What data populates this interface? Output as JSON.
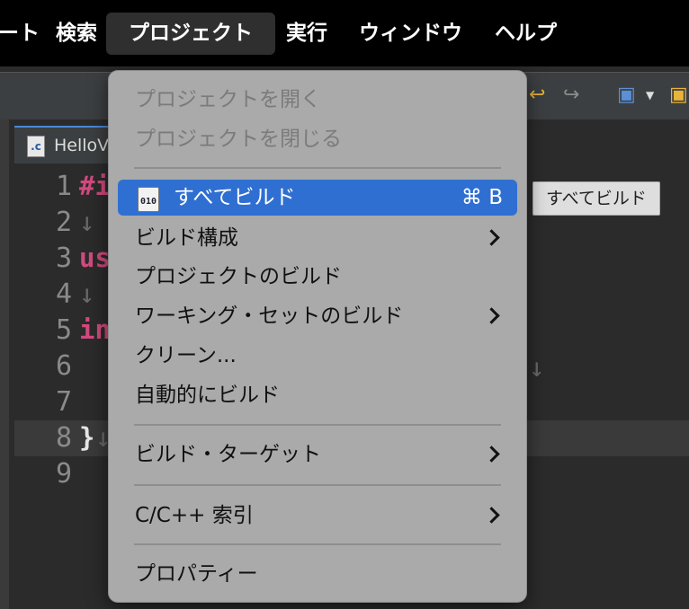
{
  "menubar": {
    "items": [
      "ート",
      "検索",
      "プロジェクト",
      "実行",
      "ウィンドウ",
      "ヘルプ"
    ]
  },
  "editor": {
    "tab_label": "HelloV",
    "file_icon_text": ".c",
    "line_numbers": [
      "1",
      "2",
      "3",
      "4",
      "5",
      "6",
      "7",
      "8",
      "9"
    ],
    "code_fragments": {
      "l1": "#i",
      "l2": "↓",
      "l3": "us",
      "l4": "↓",
      "l5": "in",
      "l6": "↓",
      "l8_brace": "}",
      "l8_ws": "↓"
    }
  },
  "tooltip": {
    "text": "すべてビルド"
  },
  "menu": {
    "items": [
      {
        "label": "プロジェクトを開く",
        "disabled": true
      },
      {
        "label": "プロジェクトを閉じる",
        "disabled": true
      },
      {
        "label": "すべてビルド",
        "shortcut": "⌘ B",
        "selected": true,
        "icon_text": "010"
      },
      {
        "label": "ビルド構成",
        "submenu": true
      },
      {
        "label": "プロジェクトのビルド"
      },
      {
        "label": "ワーキング・セットのビルド",
        "submenu": true
      },
      {
        "label": "クリーン..."
      },
      {
        "label": "自動的にビルド"
      },
      {
        "label": "ビルド・ターゲット",
        "submenu": true
      },
      {
        "label": "C/C++ 索引",
        "submenu": true
      },
      {
        "label": "プロパティー"
      }
    ]
  },
  "colors": {
    "menubar_bg": "#000000",
    "menu_bg": "#a9aaa9",
    "selected_bg": "#2f6fd2",
    "keyword": "#d14a7e"
  }
}
